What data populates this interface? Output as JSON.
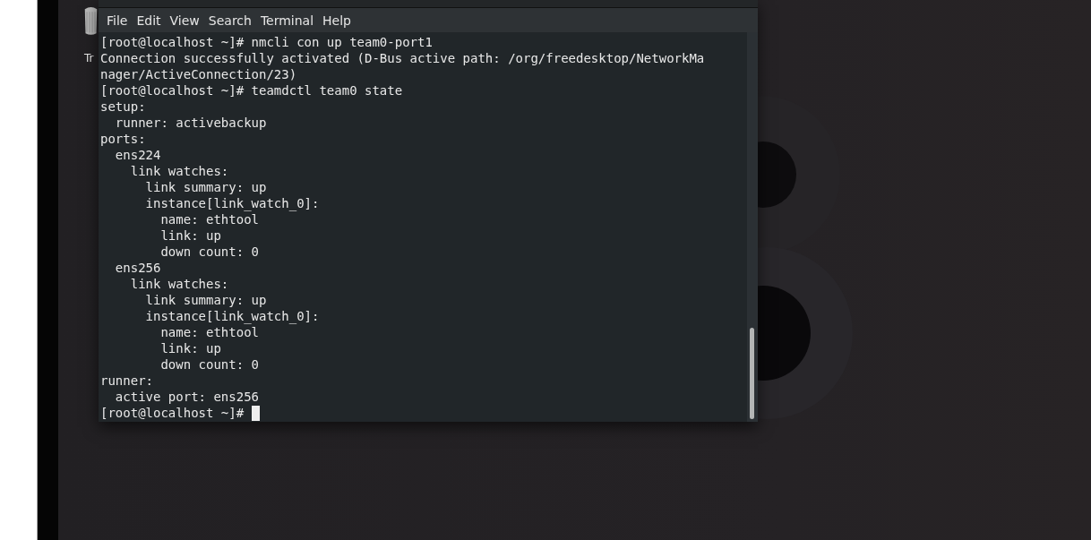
{
  "desktop": {
    "icons": [
      {
        "label": "Tr"
      }
    ]
  },
  "terminal": {
    "menu": [
      "File",
      "Edit",
      "View",
      "Search",
      "Terminal",
      "Help"
    ],
    "lines": [
      "[root@localhost ~]# nmcli con up team0-port1",
      "Connection successfully activated (D-Bus active path: /org/freedesktop/NetworkMa",
      "nager/ActiveConnection/23)",
      "[root@localhost ~]# teamdctl team0 state",
      "setup:",
      "  runner: activebackup",
      "ports:",
      "  ens224",
      "    link watches:",
      "      link summary: up",
      "      instance[link_watch_0]:",
      "        name: ethtool",
      "        link: up",
      "        down count: 0",
      "  ens256",
      "    link watches:",
      "      link summary: up",
      "      instance[link_watch_0]:",
      "        name: ethtool",
      "        link: up",
      "        down count: 0",
      "runner:",
      "  active port: ens256",
      "[root@localhost ~]# "
    ]
  }
}
